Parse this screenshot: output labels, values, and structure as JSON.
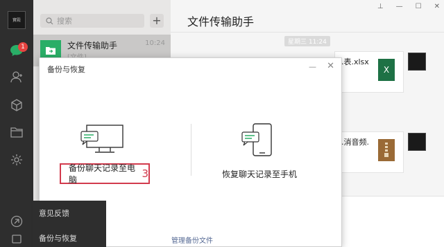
{
  "rail": {
    "avatar_text": "寶殿",
    "unread_badge": "1"
  },
  "list": {
    "search_placeholder": "搜索",
    "add_label": "+",
    "chat_items": [
      {
        "name": "文件传输助手",
        "time": "10:24",
        "preview": "[文件]"
      }
    ]
  },
  "chat": {
    "title": "文件传输助手",
    "time_chip": "星期三 11:24",
    "files": [
      {
        "name": "...表.xlsx",
        "type": "excel",
        "icon_text": "X"
      },
      {
        "name": "...消音频.",
        "type": "zip",
        "icon_text": ""
      }
    ]
  },
  "dialog": {
    "title": "备份与恢复",
    "backup_label": "备份聊天记录至电脑",
    "step_marker": "3",
    "restore_label": "恢复聊天记录至手机",
    "manage_link": "管理备份文件"
  },
  "popup": {
    "items": [
      "意见反馈",
      "备份与恢复"
    ]
  },
  "colors": {
    "accent_green": "#2aae67",
    "highlight_red": "#d23a4d",
    "link_blue": "#576b95",
    "badge_red": "#e64340",
    "excel_green": "#1e7145",
    "zip_brown": "#9a6a36"
  }
}
